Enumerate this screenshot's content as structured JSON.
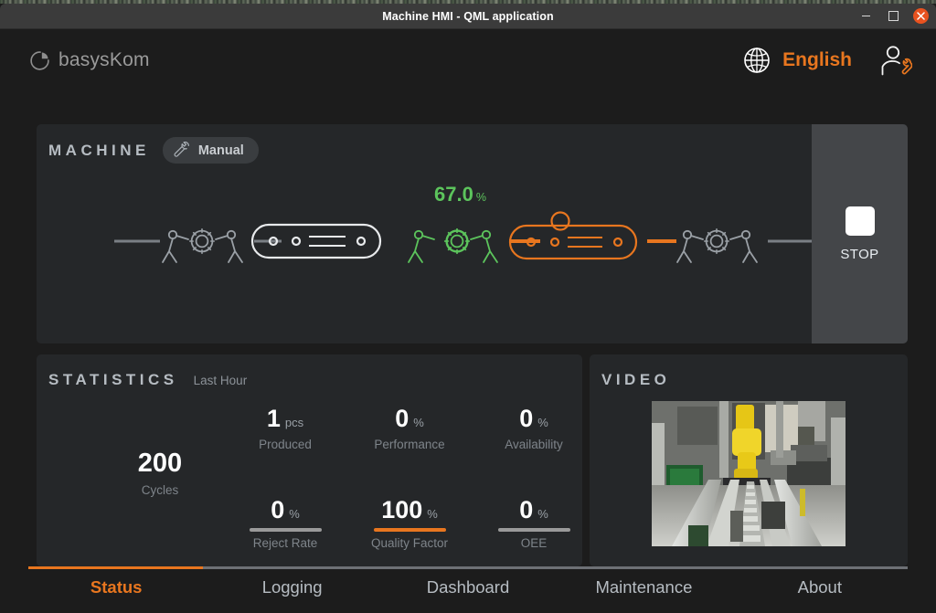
{
  "window": {
    "title": "Machine HMI - QML application",
    "buttons": {
      "minimize": "minimize-window",
      "maximize": "maximize-window",
      "close": "close-window"
    }
  },
  "header": {
    "brand": "basysKom",
    "brand_icon": "pie-logo-icon",
    "language_icon": "globe-icon",
    "language": "English",
    "user_icon": "user-settings-icon"
  },
  "machine": {
    "title": "MACHINE",
    "mode_icon": "wrench-icon",
    "mode": "Manual",
    "throughput_value": "67.0",
    "throughput_unit": "%",
    "throughput_color": "#5cc45c",
    "stop_button": "STOP",
    "stages": [
      {
        "name": "segment-left-idle",
        "state": "idle",
        "color": "#7a7f85"
      },
      {
        "name": "robot-gear-left",
        "state": "idle",
        "color": "#9aa0a6"
      },
      {
        "name": "conveyor-idle",
        "state": "idle",
        "color": "#e8eaec"
      },
      {
        "name": "robot-gear-active",
        "state": "running",
        "color": "#5cc45c"
      },
      {
        "name": "conveyor-active",
        "state": "running",
        "color": "#e8761f"
      },
      {
        "name": "robot-gear-right",
        "state": "idle",
        "color": "#9aa0a6"
      },
      {
        "name": "segment-right-idle",
        "state": "idle",
        "color": "#7a7f85"
      }
    ]
  },
  "statistics": {
    "title": "STATISTICS",
    "subtitle": "Last Hour",
    "cycles": {
      "value": "200",
      "unit": "",
      "label": "Cycles"
    },
    "items": [
      {
        "value": "1",
        "unit": "pcs",
        "label": "Produced",
        "bar": false,
        "bar_color": ""
      },
      {
        "value": "0",
        "unit": "%",
        "label": "Performance",
        "bar": false,
        "bar_color": ""
      },
      {
        "value": "0",
        "unit": "%",
        "label": "Availability",
        "bar": false,
        "bar_color": ""
      },
      {
        "value": "0",
        "unit": "%",
        "label": "Reject Rate",
        "bar": true,
        "bar_color": "#9a9a9a"
      },
      {
        "value": "100",
        "unit": "%",
        "label": "Quality Factor",
        "bar": true,
        "bar_color": "#e8761f"
      },
      {
        "value": "0",
        "unit": "%",
        "label": "OEE",
        "bar": true,
        "bar_color": "#9a9a9a"
      }
    ]
  },
  "video": {
    "title": "VIDEO",
    "feed": "factory-conveyor-robot-camera-feed"
  },
  "tabs": {
    "active_index": 0,
    "items": [
      {
        "label": "Status"
      },
      {
        "label": "Logging"
      },
      {
        "label": "Dashboard"
      },
      {
        "label": "Maintenance"
      },
      {
        "label": "About"
      }
    ]
  },
  "colors": {
    "accent": "#e8761f",
    "running": "#5cc45c",
    "panel": "#252729",
    "background": "#1c1c1c",
    "titlebar": "#3b3b3b",
    "close_button": "#e8521f"
  }
}
